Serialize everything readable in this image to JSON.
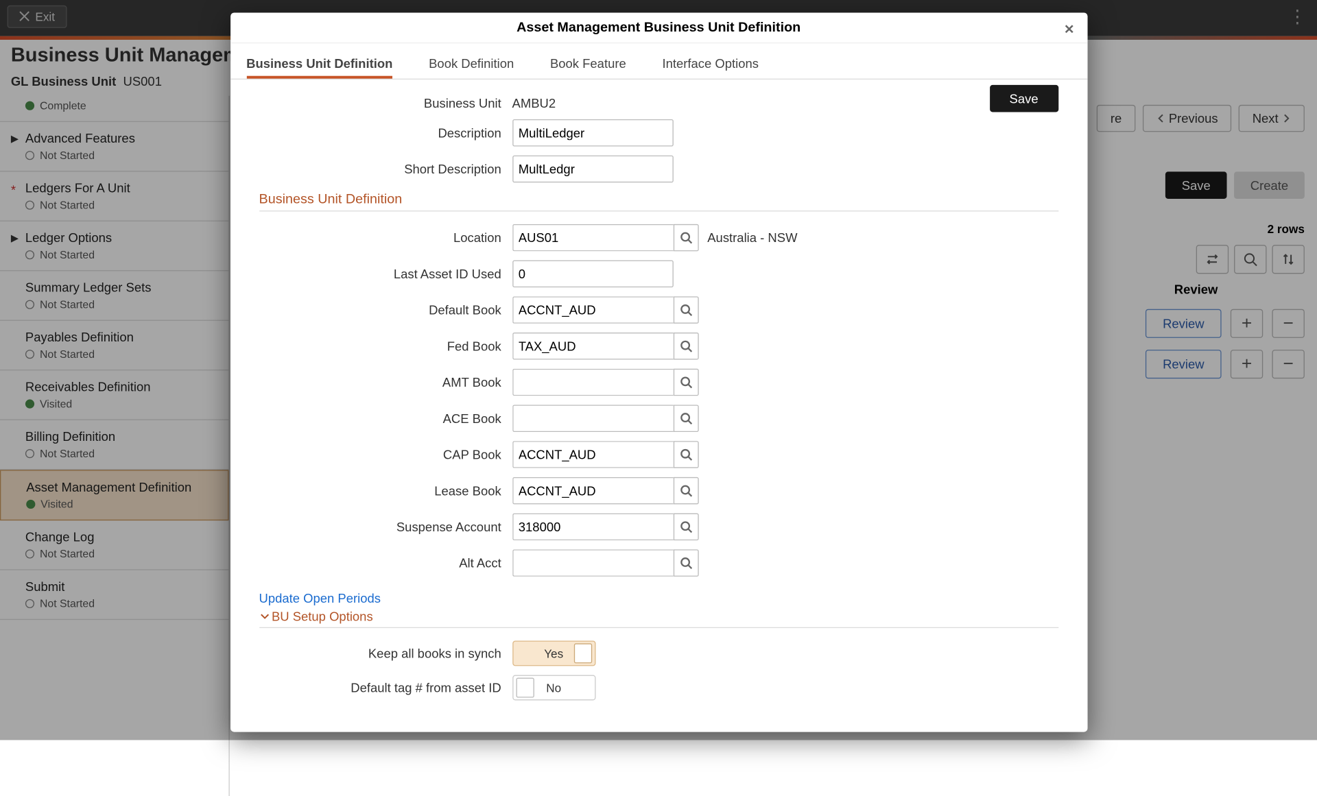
{
  "topbar": {
    "exit": "Exit"
  },
  "header": {
    "title": "Business Unit Management",
    "gl_label": "GL Business Unit",
    "gl_value": "US001"
  },
  "buttons": {
    "previous": "Previous",
    "next": "Next",
    "save": "Save",
    "create": "Create",
    "review": "Review",
    "rows": "2 rows",
    "col_review": "Review",
    "share": "re"
  },
  "sidebar": [
    {
      "title": "Complete",
      "status": "Complete",
      "kind": "complete",
      "chev": false
    },
    {
      "title": "Advanced Features",
      "status": "Not Started",
      "kind": "notstarted",
      "chev": true
    },
    {
      "title": "Ledgers For A Unit",
      "status": "Not Started",
      "kind": "notstarted",
      "req": true
    },
    {
      "title": "Ledger Options",
      "status": "Not Started",
      "kind": "notstarted",
      "chev": true
    },
    {
      "title": "Summary Ledger Sets",
      "status": "Not Started",
      "kind": "notstarted"
    },
    {
      "title": "Payables Definition",
      "status": "Not Started",
      "kind": "notstarted"
    },
    {
      "title": "Receivables Definition",
      "status": "Visited",
      "kind": "visited"
    },
    {
      "title": "Billing Definition",
      "status": "Not Started",
      "kind": "notstarted"
    },
    {
      "title": "Asset Management Definition",
      "status": "Visited",
      "kind": "visited",
      "selected": true
    },
    {
      "title": "Change Log",
      "status": "Not Started",
      "kind": "notstarted"
    },
    {
      "title": "Submit",
      "status": "Not Started",
      "kind": "notstarted"
    }
  ],
  "modal": {
    "title": "Asset Management Business Unit Definition",
    "tabs": [
      "Business Unit Definition",
      "Book Definition",
      "Book Feature",
      "Interface Options"
    ],
    "save": "Save",
    "bu_label": "Business Unit",
    "bu_value": "AMBU2",
    "desc_label": "Description",
    "desc_value": "MultiLedger",
    "sdesc_label": "Short Description",
    "sdesc_value": "MultLedgr",
    "section1": "Business Unit Definition",
    "location_label": "Location",
    "location_value": "AUS01",
    "location_aside": "Australia - NSW",
    "lastasset_label": "Last Asset ID Used",
    "lastasset_value": "0",
    "defbook_label": "Default Book",
    "defbook_value": "ACCNT_AUD",
    "fedbook_label": "Fed Book",
    "fedbook_value": "TAX_AUD",
    "amtbook_label": "AMT Book",
    "amtbook_value": "",
    "acebook_label": "ACE Book",
    "acebook_value": "",
    "capbook_label": "CAP Book",
    "capbook_value": "ACCNT_AUD",
    "leasebook_label": "Lease Book",
    "leasebook_value": "ACCNT_AUD",
    "suspense_label": "Suspense Account",
    "suspense_value": "318000",
    "altacct_label": "Alt Acct",
    "altacct_value": "",
    "update_link": "Update Open Periods",
    "busetup": "BU Setup Options",
    "keepbooks_label": "Keep all books in synch",
    "keepbooks_value": "Yes",
    "deftag_label": "Default tag # from asset ID",
    "deftag_value": "No"
  }
}
